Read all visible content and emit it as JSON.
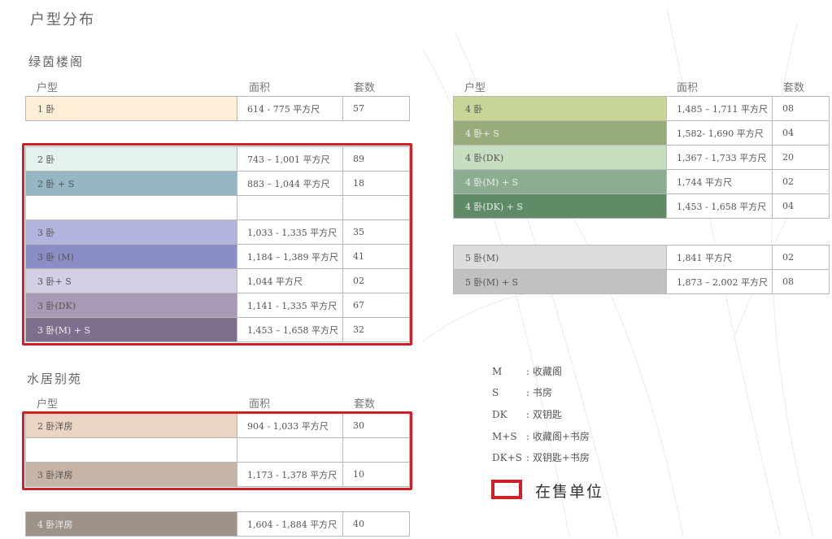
{
  "page_title": "户型分布",
  "colors": {
    "highlight_frame": "#d21f25"
  },
  "section_lvyin": {
    "title": "绿茵楼阁",
    "headers": {
      "type": "户型",
      "area": "面积",
      "count": "套数"
    },
    "rows": [
      {
        "type": "1 卧",
        "area": "614 - 775 平方尺",
        "count": "57",
        "color": "#fcefd6"
      },
      {
        "type": "2 卧",
        "area": "743 – 1,001 平方尺",
        "count": "89",
        "color": "#e4f1ee"
      },
      {
        "type": "2 卧 + S",
        "area": "883 – 1,044 平方尺",
        "count": "18",
        "color": "#95b6c2"
      },
      {
        "type": "3 卧",
        "area": "1,033 - 1,335 平方尺",
        "count": "35",
        "color": "#b3b4dd"
      },
      {
        "type": "3 卧 (M)",
        "area": "1,184 – 1,389 平方尺",
        "count": "41",
        "color": "#8b8ec6"
      },
      {
        "type": "3 卧+ S",
        "area": "1,044 平方尺",
        "count": "02",
        "color": "#d4cfe5"
      },
      {
        "type": "3 卧(DK)",
        "area": "1,141 - 1,335 平方尺",
        "count": "67",
        "color": "#a89ab6"
      },
      {
        "type": "3 卧(M) + S",
        "area": "1,453 – 1,658 平方尺",
        "count": "32",
        "color": "#7e6f8e"
      }
    ]
  },
  "section_right": {
    "headers": {
      "type": "户型",
      "area": "面积",
      "count": "套数"
    },
    "rows": [
      {
        "type": "4 卧",
        "area": "1,485 – 1,711 平方尺",
        "count": "08",
        "color": "#c7d596"
      },
      {
        "type": "4 卧+ S",
        "area": "1,582- 1,690 平方尺",
        "count": "04",
        "color": "#98ac79"
      },
      {
        "type": "4 卧(DK)",
        "area": "1,367 - 1,733 平方尺",
        "count": "20",
        "color": "#c6dfc1"
      },
      {
        "type": "4 卧(M) + S",
        "area": "1,744 平方尺",
        "count": "02",
        "color": "#8dad90"
      },
      {
        "type": "4 卧(DK) + S",
        "area": "1,453 - 1,658 平方尺",
        "count": "04",
        "color": "#5f8b66"
      },
      {
        "type": "5 卧(M)",
        "area": "1,841 平方尺",
        "count": "02",
        "color": "#dcdcdd"
      },
      {
        "type": "5 卧(M) + S",
        "area": "1,873 – 2,002 平方尺",
        "count": "08",
        "color": "#c1c1c3"
      }
    ]
  },
  "section_shuiju": {
    "title": "水居别苑",
    "headers": {
      "type": "户型",
      "area": "面积",
      "count": "套数"
    },
    "rows": [
      {
        "type": "2 卧洋房",
        "area": "904 - 1,033 平方尺",
        "count": "30",
        "color": "#ead4c2"
      },
      {
        "type": "3 卧洋房",
        "area": "1,173 - 1,378 平方尺",
        "count": "10",
        "color": "#c6b5a6"
      },
      {
        "type": "4 卧洋房",
        "area": "1,604 - 1,884 平方尺",
        "count": "40",
        "color": "#9d9387"
      }
    ]
  },
  "legend": {
    "items": [
      {
        "key": "M",
        "desc": ": 收藏阁"
      },
      {
        "key": "S",
        "desc": ": 书房"
      },
      {
        "key": "DK",
        "desc": ": 双钥匙"
      },
      {
        "key": "M+S",
        "desc": ": 收藏阁+书房"
      },
      {
        "key": "DK+S",
        "desc": ": 双钥匙+书房"
      }
    ],
    "on_sale_label": "在售单位"
  }
}
